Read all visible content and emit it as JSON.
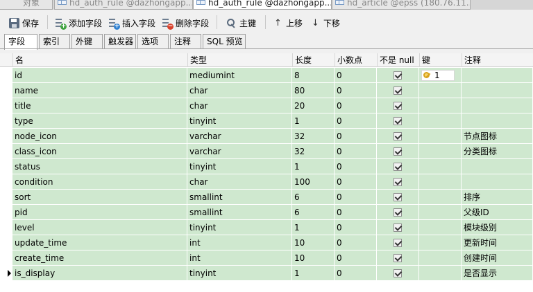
{
  "doc_tabs": [
    {
      "label": "对象",
      "active": false
    },
    {
      "label": "hd_auth_rule @dazhongapp...",
      "active": false
    },
    {
      "label": "hd_auth_rule @dazhongapp...",
      "active": true
    },
    {
      "label": "hd_article @epss (180.76.11...",
      "active": false
    }
  ],
  "toolbar": {
    "save": "保存",
    "add_field": "添加字段",
    "insert_field": "插入字段",
    "delete_field": "删除字段",
    "primary_key": "主键",
    "move_up": "上移",
    "move_down": "下移"
  },
  "sub_tabs": [
    "字段",
    "索引",
    "外键",
    "触发器",
    "选项",
    "注释",
    "SQL 预览"
  ],
  "active_sub_tab": "字段",
  "columns": [
    "名",
    "类型",
    "长度",
    "小数点",
    "不是 null",
    "键",
    "注释"
  ],
  "rows": [
    {
      "name": "id",
      "type": "mediumint",
      "length": "8",
      "decimals": "0",
      "not_null": true,
      "key": "1",
      "comment": ""
    },
    {
      "name": "name",
      "type": "char",
      "length": "80",
      "decimals": "0",
      "not_null": true,
      "key": "",
      "comment": ""
    },
    {
      "name": "title",
      "type": "char",
      "length": "20",
      "decimals": "0",
      "not_null": true,
      "key": "",
      "comment": ""
    },
    {
      "name": "type",
      "type": "tinyint",
      "length": "1",
      "decimals": "0",
      "not_null": true,
      "key": "",
      "comment": ""
    },
    {
      "name": "node_icon",
      "type": "varchar",
      "length": "32",
      "decimals": "0",
      "not_null": true,
      "key": "",
      "comment": "节点图标"
    },
    {
      "name": "class_icon",
      "type": "varchar",
      "length": "32",
      "decimals": "0",
      "not_null": true,
      "key": "",
      "comment": "分类图标"
    },
    {
      "name": "status",
      "type": "tinyint",
      "length": "1",
      "decimals": "0",
      "not_null": true,
      "key": "",
      "comment": ""
    },
    {
      "name": "condition",
      "type": "char",
      "length": "100",
      "decimals": "0",
      "not_null": true,
      "key": "",
      "comment": ""
    },
    {
      "name": "sort",
      "type": "smallint",
      "length": "6",
      "decimals": "0",
      "not_null": true,
      "key": "",
      "comment": "排序"
    },
    {
      "name": "pid",
      "type": "smallint",
      "length": "6",
      "decimals": "0",
      "not_null": true,
      "key": "",
      "comment": "父级ID"
    },
    {
      "name": "level",
      "type": "tinyint",
      "length": "1",
      "decimals": "0",
      "not_null": true,
      "key": "",
      "comment": "模块级别"
    },
    {
      "name": "update_time",
      "type": "int",
      "length": "10",
      "decimals": "0",
      "not_null": true,
      "key": "",
      "comment": "更新时间"
    },
    {
      "name": "create_time",
      "type": "int",
      "length": "10",
      "decimals": "0",
      "not_null": true,
      "key": "",
      "comment": "创建时间"
    },
    {
      "name": "is_display",
      "type": "tinyint",
      "length": "1",
      "decimals": "0",
      "not_null": true,
      "key": "",
      "comment": "是否显示",
      "current": true
    }
  ],
  "colors": {
    "row_bg": "#cfe8cf",
    "header_bg": "#f4f4f4",
    "key_icon": "#d8a21d"
  }
}
